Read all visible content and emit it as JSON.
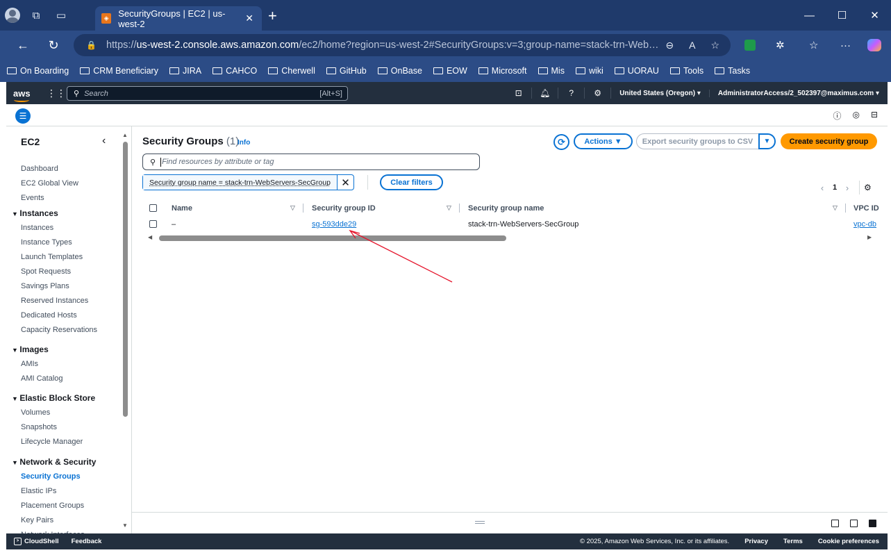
{
  "browser": {
    "tab_title": "SecurityGroups | EC2 | us-west-2",
    "url_prefix": "https://",
    "url_host": "us-west-2.console.aws.amazon.com",
    "url_rest": "/ec2/home?region=us-west-2#SecurityGroups:v=3;group-name=stack-trn-Web…",
    "bookmarks": [
      "On Boarding",
      "CRM Beneficiary",
      "JIRA",
      "CAHCO",
      "Cherwell",
      "GitHub",
      "OnBase",
      "EOW",
      "Microsoft",
      "Mis",
      "wiki",
      "UORAU",
      "Tools",
      "Tasks"
    ]
  },
  "aws": {
    "logo": "aws",
    "search_placeholder": "Search",
    "search_shortcut": "[Alt+S]",
    "region": "United States (Oregon) ▾",
    "account": "AdministratorAccess/2_502397@maximus.com ▾"
  },
  "sidebar": {
    "title": "EC2",
    "top_items": [
      "Dashboard",
      "EC2 Global View",
      "Events"
    ],
    "sections": [
      {
        "title": "Instances",
        "items": [
          "Instances",
          "Instance Types",
          "Launch Templates",
          "Spot Requests",
          "Savings Plans",
          "Reserved Instances",
          "Dedicated Hosts",
          "Capacity Reservations"
        ]
      },
      {
        "title": "Images",
        "items": [
          "AMIs",
          "AMI Catalog"
        ]
      },
      {
        "title": "Elastic Block Store",
        "items": [
          "Volumes",
          "Snapshots",
          "Lifecycle Manager"
        ]
      },
      {
        "title": "Network & Security",
        "items": [
          "Security Groups",
          "Elastic IPs",
          "Placement Groups",
          "Key Pairs",
          "Network Interfaces"
        ]
      }
    ],
    "active_item": "Security Groups"
  },
  "main": {
    "title": "Security Groups",
    "count": "(1)",
    "info": "Info",
    "actions_label": "Actions",
    "export_label": "Export security groups to CSV",
    "create_label": "Create security group",
    "filter_placeholder": "Find resources by attribute or tag",
    "token": "Security group name = stack-trn-WebServers-SecGroup",
    "clear_filters": "Clear filters",
    "page": "1",
    "columns": [
      "Name",
      "Security group ID",
      "Security group name",
      "VPC ID"
    ],
    "rows": [
      {
        "name": "–",
        "id": "sg-593dde29",
        "group_name": "stack-trn-WebServers-SecGroup",
        "vpc": "vpc-db"
      }
    ]
  },
  "footer": {
    "cloudshell": "CloudShell",
    "feedback": "Feedback",
    "copyright": "© 2025, Amazon Web Services, Inc. or its affiliates.",
    "privacy": "Privacy",
    "terms": "Terms",
    "cookies": "Cookie preferences"
  },
  "colors": {
    "accent": "#0972d3",
    "create": "#ff9900",
    "nav": "#232f3e",
    "browser": "#2c4c86"
  }
}
